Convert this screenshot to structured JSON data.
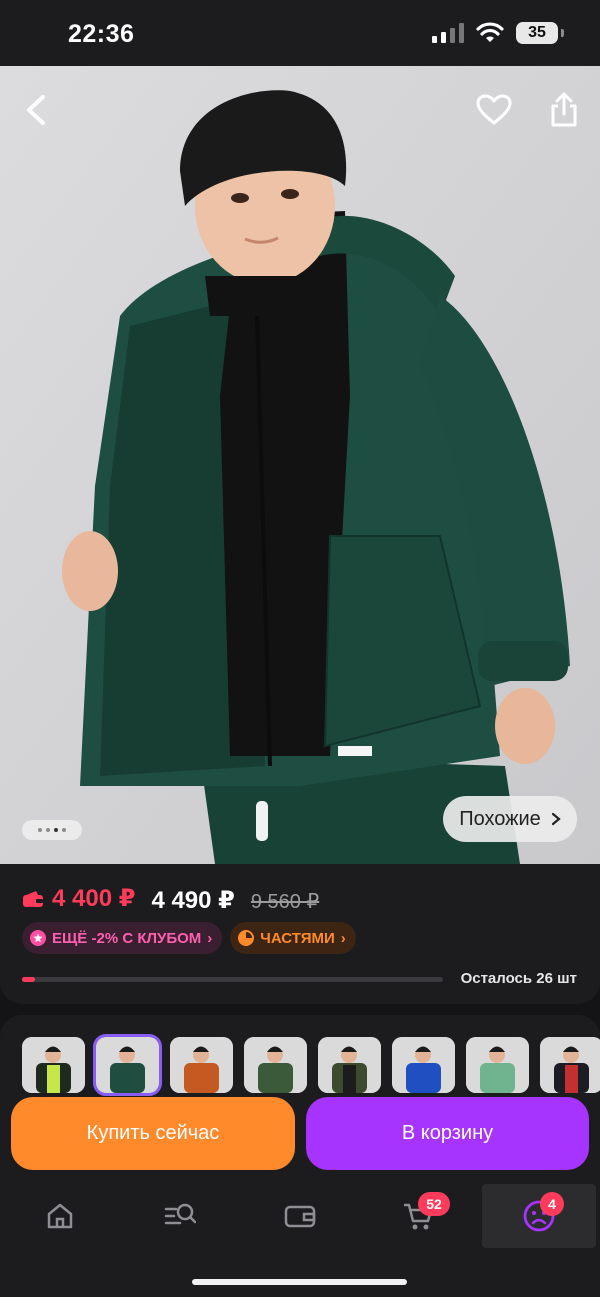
{
  "status_bar": {
    "time": "22:36",
    "battery": "35"
  },
  "similar_label": "Похожие",
  "price": {
    "card_price": "4 400 ₽",
    "price": "4 490 ₽",
    "old_price": "9 560 ₽"
  },
  "badges": {
    "club": "ЕЩЁ -2% С КЛУБОМ",
    "parts": "ЧАСТЯМИ"
  },
  "stock": {
    "label": "Осталось 26 шт",
    "remaining_fraction": 0.03
  },
  "thumbnails": [
    {
      "jacket": "#1f2a1e",
      "accent": "#c7e64a"
    },
    {
      "jacket": "#1f4d40",
      "accent": "#1f4d40"
    },
    {
      "jacket": "#c45a22",
      "accent": "#c45a22"
    },
    {
      "jacket": "#3a5a3a",
      "accent": "#3a5a3a"
    },
    {
      "jacket": "#3c4a2e",
      "accent": "#1c1c1c"
    },
    {
      "jacket": "#1f4fc0",
      "accent": "#1f4fc0"
    },
    {
      "jacket": "#6fb48f",
      "accent": "#6fb48f"
    },
    {
      "jacket": "#1c1c24",
      "accent": "#c43030"
    }
  ],
  "buttons": {
    "buy_now": "Купить сейчас",
    "add_to_cart": "В корзину"
  },
  "tabbar": {
    "cart_count": "52",
    "profile_count": "4"
  },
  "colors": {
    "accent_red": "#ff3b5c",
    "orange": "#ff8a2b",
    "purple": "#a733ff"
  }
}
